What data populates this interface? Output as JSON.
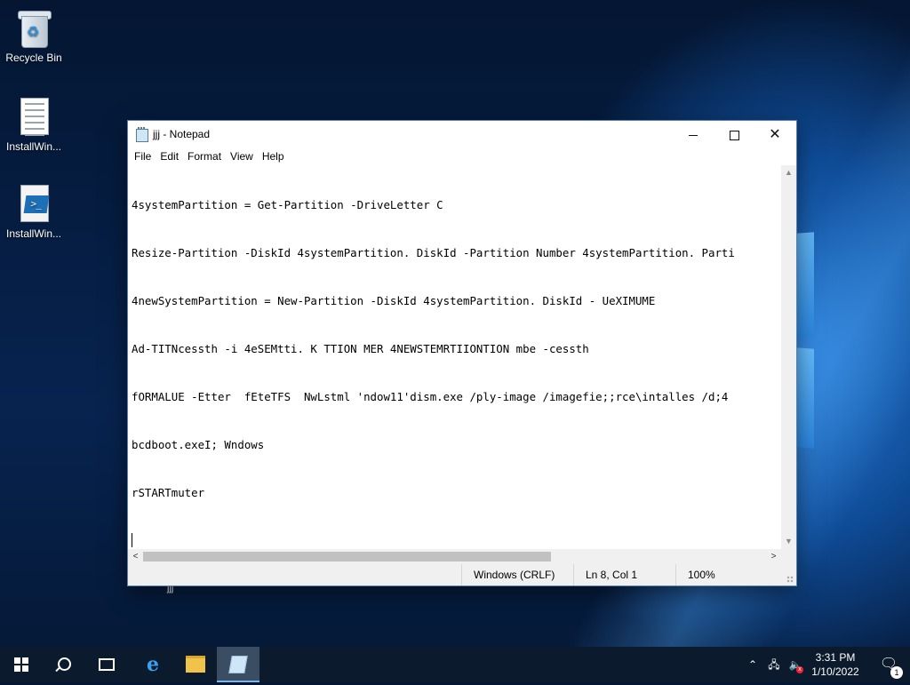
{
  "desktop": {
    "icons": [
      {
        "label": "Recycle Bin",
        "icon": "recycle-bin-icon"
      },
      {
        "label": "InstallWin...",
        "icon": "text-file-icon"
      },
      {
        "label": "InstallWin...",
        "icon": "powershell-script-icon"
      }
    ],
    "stray_label": "jjj"
  },
  "notepad": {
    "title": "jjj - Notepad",
    "menu": [
      "File",
      "Edit",
      "Format",
      "View",
      "Help"
    ],
    "lines": [
      "4systemPartition = Get-Partition -DriveLetter C",
      "Resize-Partition -DiskId 4systemPartition. DiskId -Partition Number 4systemPartition. Parti",
      "4newSystemPartition = New-Partition -DiskId 4systemPartition. DiskId - UeXIMUME",
      "Ad-TITNcessth -i 4eSEMtti. K TTION MER 4NEWSTEMRTIIONTION mbe -cessth",
      "fORMALUE -Etter  fEteTFS  NwLstml 'ndow11'dism.exe /ply-image /imagefie;;rce\\intalles /d;4",
      "bcdboot.exeI; Wndows",
      "rSTARTmuter",
      ""
    ],
    "status": {
      "line_ending": "Windows (CRLF)",
      "position": "Ln 8, Col 1",
      "zoom": "100%"
    }
  },
  "taskbar": {
    "clock_time": "3:31 PM",
    "clock_date": "1/10/2022",
    "notification_count": "1",
    "accent": "#7db6e8"
  }
}
